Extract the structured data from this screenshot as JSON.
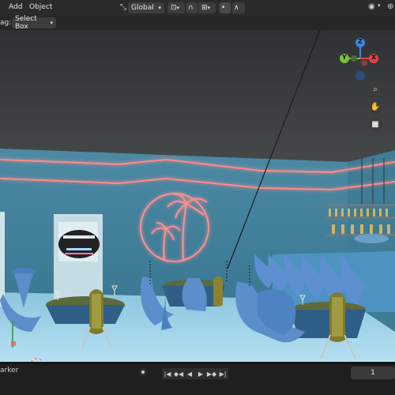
{
  "header": {
    "menu": [
      "Add",
      "Object"
    ],
    "transform_orientation": "Global",
    "snap_icon": "magnet-icon",
    "proportional_icon": "proportional-edit-icon"
  },
  "toolbar": {
    "drag_label": "ag:",
    "drag_value": "Select Box"
  },
  "viewport": {
    "gizmo_axes": [
      "Z",
      "Y",
      "X"
    ],
    "nav_icons": [
      "zoom-icon",
      "hand-pan-icon",
      "camera-icon"
    ]
  },
  "timeline": {
    "left_label": "arker",
    "frame": "1",
    "controls": [
      "jump-start-icon",
      "prev-keyframe-icon",
      "play-reverse-icon",
      "play-icon",
      "next-keyframe-icon",
      "jump-end-icon"
    ]
  },
  "colors": {
    "neon": "#ff7f7f",
    "wall": "#3e7f9a",
    "ceiling": "#373a3b",
    "floor": "#9fd0e6",
    "x_axis": "#e0404a",
    "y_axis": "#7fbf3a",
    "z_axis": "#3f84e0"
  }
}
